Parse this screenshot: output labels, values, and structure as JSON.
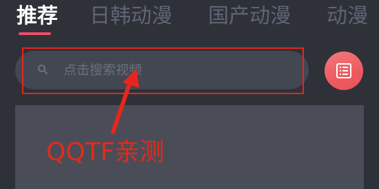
{
  "tabs": [
    {
      "label": "推荐",
      "active": true
    },
    {
      "label": "日韩动漫",
      "active": false
    },
    {
      "label": "国产动漫",
      "active": false
    },
    {
      "label": "动漫",
      "active": false
    }
  ],
  "search": {
    "placeholder": "点击搜索视频",
    "value": "",
    "icon": "search-icon"
  },
  "menu_button": {
    "icon": "list-icon"
  },
  "annotation": {
    "text": "QQTF亲测"
  },
  "colors": {
    "background": "#2f3139",
    "search_background": "#434752",
    "banner_background": "#4a4d57",
    "accent": "#ee4d6a",
    "annotation_red": "#e8261c",
    "active_tab": "#ffffff",
    "inactive_tab": "#5f6574"
  }
}
